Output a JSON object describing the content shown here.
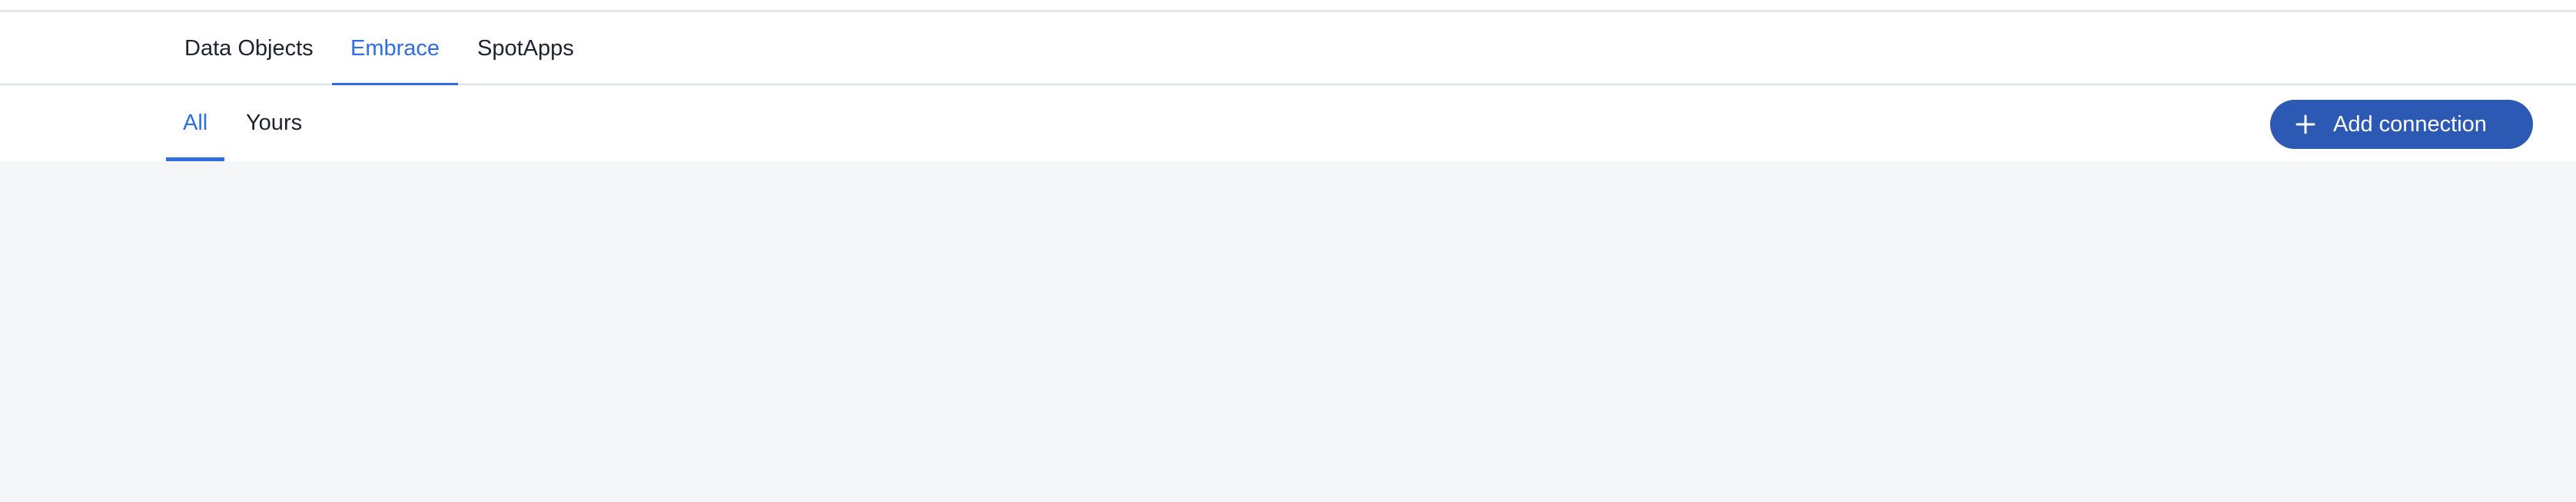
{
  "main_tabs": [
    {
      "label": "Data Objects",
      "active": false
    },
    {
      "label": "Embrace",
      "active": true
    },
    {
      "label": "SpotApps",
      "active": false
    }
  ],
  "sub_tabs": [
    {
      "label": "All",
      "active": true
    },
    {
      "label": "Yours",
      "active": false
    }
  ],
  "toolbar": {
    "add_connection_label": "Add connection",
    "add_icon": "plus-icon"
  },
  "colors": {
    "accent": "#2f6de0",
    "button_bg": "#2b59b3",
    "canvas_bg": "#f5f6f8"
  }
}
